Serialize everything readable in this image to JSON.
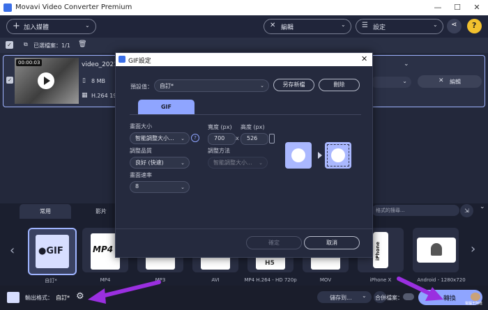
{
  "window": {
    "title": "Movavi Video Converter Premium",
    "minimize": "—",
    "maximize": "☐",
    "close": "✕"
  },
  "toolbar": {
    "add_media": "加入媒體",
    "edit": "編輯",
    "settings": "設定",
    "help": "?"
  },
  "listbar": {
    "selected_files": "已選檔案：1/1"
  },
  "file": {
    "name": "video_20210",
    "duration": "00:00:03",
    "size": "8 MB",
    "codec": "H.264 19",
    "edit_button": "編輯"
  },
  "bottom": {
    "tabs": [
      "常用",
      "影片"
    ],
    "search_placeholder": "格式的搜尋...",
    "formats": [
      {
        "label": "自訂*",
        "icon": "gif-icon",
        "selected": true
      },
      {
        "label": "MP4",
        "icon": "mp4-icon",
        "selected": false
      },
      {
        "label": "MP3",
        "icon": "mp3-icon",
        "selected": false
      },
      {
        "label": "AVI",
        "icon": "avi-icon",
        "selected": false
      },
      {
        "label": "MP4 H.264 - HD 720p",
        "icon": "h264-icon",
        "selected": false
      },
      {
        "label": "MOV",
        "icon": "mov-icon",
        "selected": false
      },
      {
        "label": "iPhone X",
        "icon": "iphone-icon",
        "selected": false
      },
      {
        "label": "Android - 1280x720",
        "icon": "android-icon",
        "selected": false
      }
    ]
  },
  "status": {
    "output_format_label": "輸出格式：",
    "output_format_value": "自訂*",
    "save_to": "儲存到...",
    "merge_files": "合併檔案：",
    "convert": "轉換"
  },
  "dialog": {
    "title": "GIF設定",
    "preset_label": "預設值：",
    "preset_value": "自訂*",
    "save_new": "另存新檔",
    "delete": "刪除",
    "tab": "GIF",
    "frame_size_label": "畫面大小",
    "frame_size_value": "智能調整大小...",
    "width_label": "寬度 (px)",
    "height_label": "高度 (px)",
    "width_value": "700",
    "height_value": "526",
    "x_sep": "x",
    "quality_label": "調整品質",
    "quality_value": "良好 (快速)",
    "resize_method_label": "調整方法",
    "resize_method_value": "智能調整大小...",
    "frame_rate_label": "畫面速率",
    "frame_rate_value": "8",
    "ok": "確定",
    "cancel": "取消"
  },
  "watermark": "電腦王阿達",
  "colors": {
    "accent": "#9fb4ff",
    "arrow": "#9a2fe0",
    "bg": "#22273a"
  }
}
